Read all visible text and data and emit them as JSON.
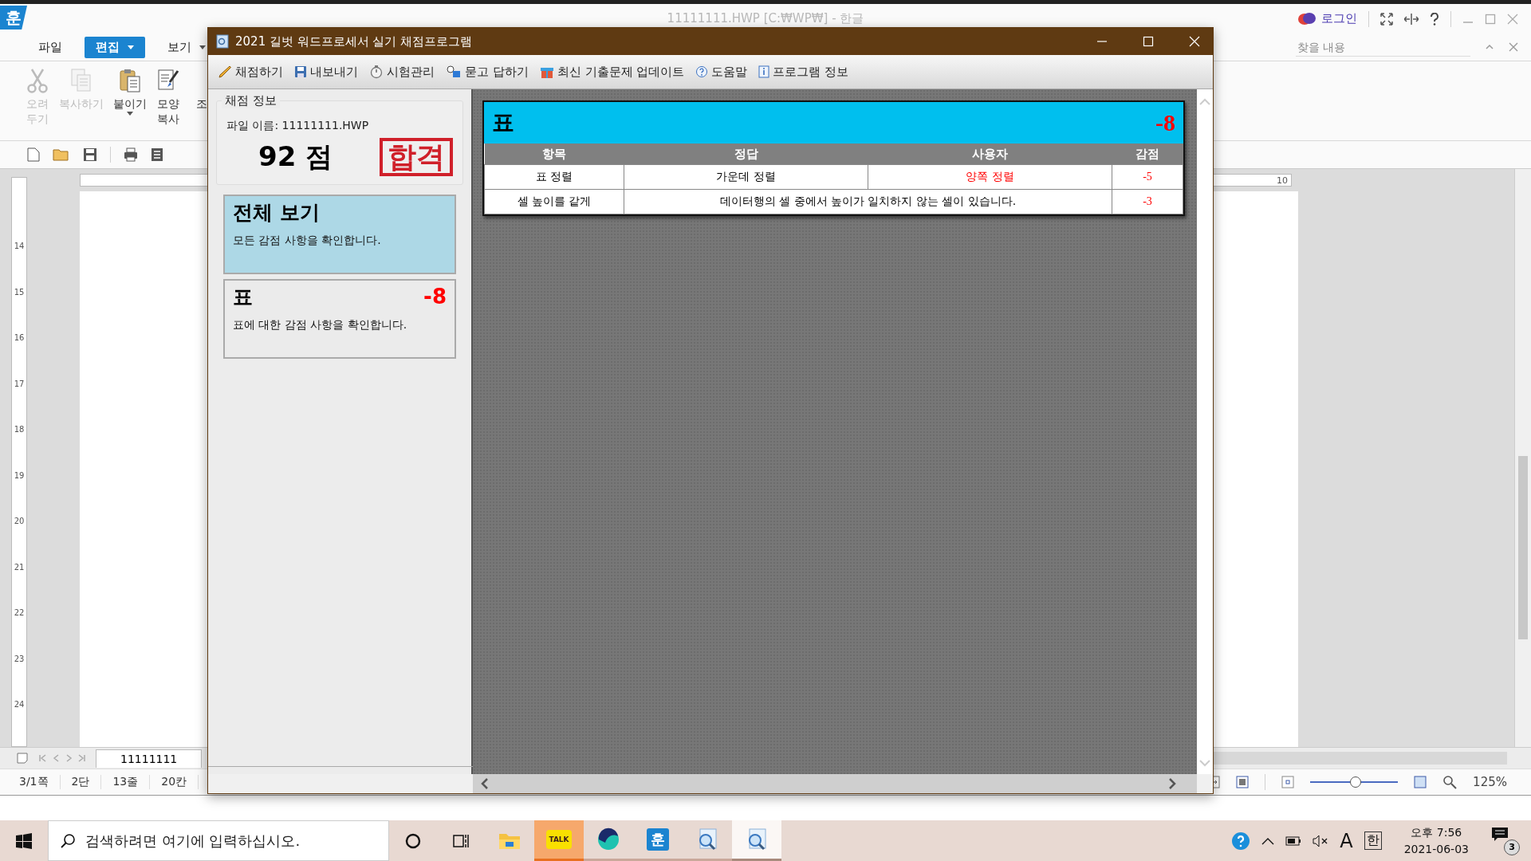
{
  "app": {
    "logo": "훈",
    "title": "11111111.HWP [C:₩WP₩] - 한글",
    "login": "로그인",
    "menu": [
      {
        "label": "파일",
        "selected": false,
        "dropdown": false
      },
      {
        "label": "편집",
        "selected": true,
        "dropdown": true
      },
      {
        "label": "보기",
        "selected": false,
        "dropdown": true
      }
    ],
    "find": {
      "placeholder": "찾을 내용"
    },
    "ribbon": [
      {
        "kind": "scissors",
        "lines": [
          "오려",
          "두기"
        ],
        "disabled": true,
        "dropdown": false
      },
      {
        "kind": "copy",
        "lines": [
          "복사하기"
        ],
        "disabled": true,
        "dropdown": false
      },
      {
        "kind": "paste",
        "lines": [
          "붙이기"
        ],
        "disabled": false,
        "dropdown": true
      },
      {
        "kind": "brush",
        "lines": [
          "모양",
          "복사"
        ],
        "disabled": false,
        "dropdown": false
      },
      {
        "kind": "cut",
        "lines": [
          "조"
        ],
        "disabled": false,
        "dropdown": false
      }
    ],
    "ruler_numbers": [
      "14",
      "15",
      "16",
      "17",
      "18",
      "19",
      "20",
      "21",
      "22",
      "23",
      "24"
    ],
    "top_ruler_number": "10",
    "doc_tab": "11111111",
    "status": [
      "3/1쪽",
      "2단",
      "13줄",
      "20칸"
    ],
    "zoom": {
      "level": 0.52,
      "reading": "125%"
    }
  },
  "dialog": {
    "title": "2021 길벗 워드프로세서 실기 채점프로그램",
    "toolbar": [
      {
        "kind": "pencil",
        "label": "채점하기"
      },
      {
        "kind": "save",
        "label": "내보내기"
      },
      {
        "kind": "timer",
        "label": "시험관리"
      },
      {
        "kind": "qa",
        "label": "묻고 답하기"
      },
      {
        "kind": "gift",
        "label": "최신 기출문제 업데이트"
      },
      {
        "kind": "help",
        "label": "도움말"
      },
      {
        "kind": "info",
        "label": "프로그램 정보"
      }
    ],
    "info": {
      "legend": "채점 정보",
      "file": "파일 이름: 11111111.HWP",
      "score": "92 점",
      "stamp": "합격"
    },
    "categories": [
      {
        "title": "전체 보기",
        "desc": "모든 감점 사항을 확인합니다.",
        "selected": true
      },
      {
        "title": "표",
        "deduction": "-8",
        "desc": "표에 대한 감점 사항을 확인합니다.",
        "selected": false
      }
    ],
    "section": {
      "title": "표",
      "deduction": "-8",
      "columns": [
        "항목",
        "정답",
        "사용자",
        "감점"
      ],
      "rows": [
        {
          "item": "표 정렬",
          "answer": "가운데 정렬",
          "user": "양쪽 정렬",
          "deduction": "-5"
        },
        {
          "item": "셀 높이를 같게",
          "answer": "데이터행의 셀 중에서 높이가 일치하지 않는 셀이 있습니다.",
          "deduction": "-3"
        }
      ]
    }
  },
  "taskbar": {
    "search_placeholder": "검색하려면 여기에 입력하십시오.",
    "apps": [
      {
        "kind": "folder",
        "running": false,
        "flashing": false,
        "selected": false
      },
      {
        "kind": "kakao",
        "label": "TALK",
        "running": true,
        "flashing": true,
        "selected": false
      },
      {
        "kind": "whale",
        "running": true,
        "flashing": false,
        "selected": false
      },
      {
        "kind": "hangul",
        "label": "훈",
        "running": true,
        "flashing": false,
        "selected": false
      },
      {
        "kind": "magnifier",
        "running": true,
        "flashing": false,
        "selected": false
      },
      {
        "kind": "magnifier",
        "running": true,
        "flashing": false,
        "selected": true
      }
    ],
    "ime_mode": "A",
    "ime_lang": "한",
    "time": "오후 7:56",
    "date": "2021-06-03",
    "notifications": "3"
  }
}
